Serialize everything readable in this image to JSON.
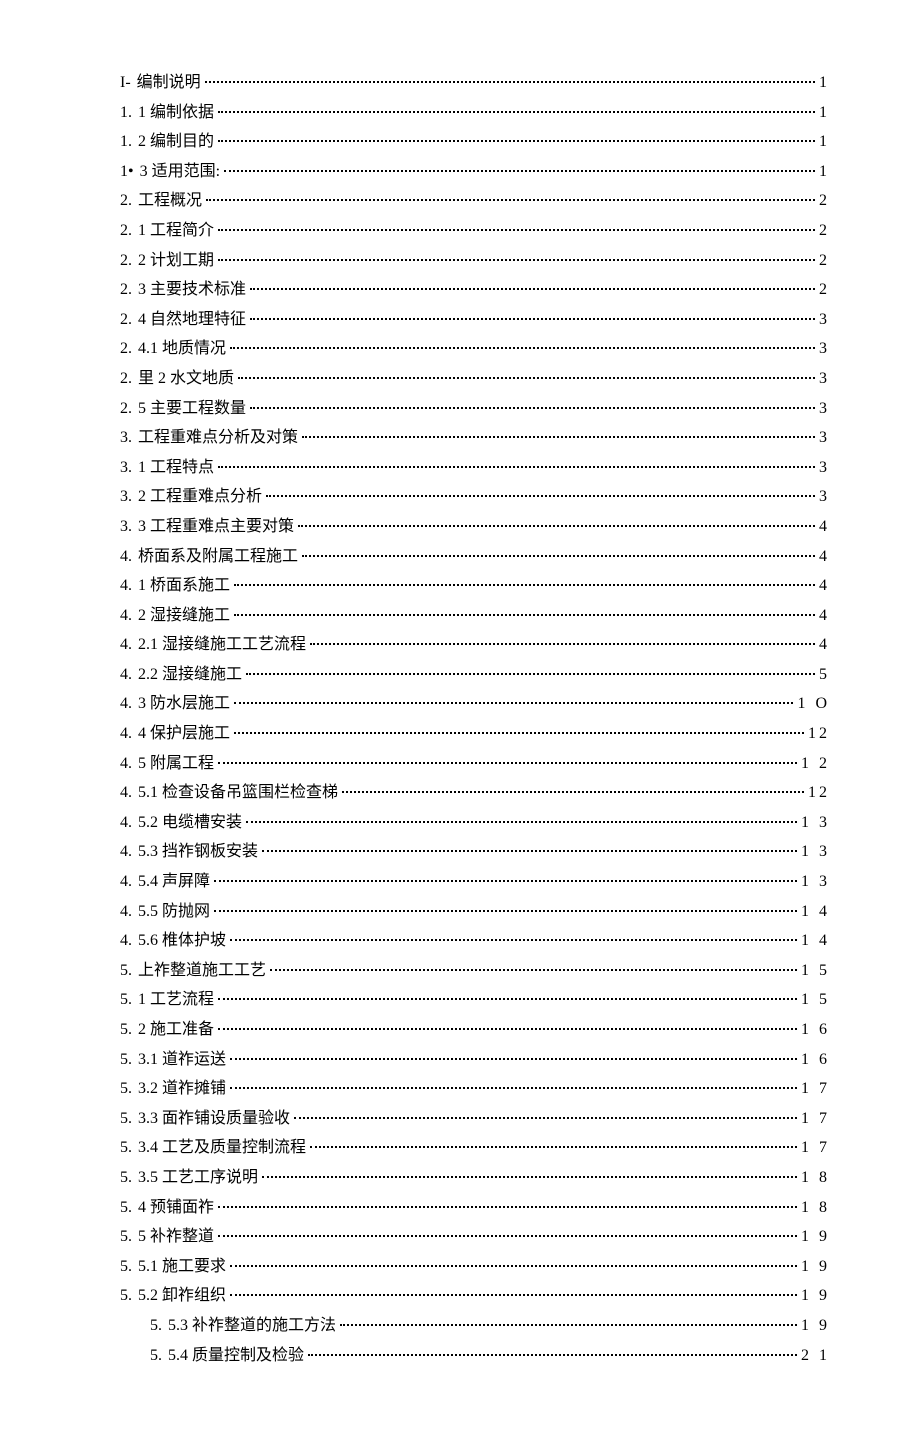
{
  "toc": [
    {
      "prefix": "I-",
      "label": "编制说明",
      "page": "1",
      "indent": 0
    },
    {
      "prefix": "1.",
      "label": "1 编制依据",
      "page": "1",
      "indent": 0
    },
    {
      "prefix": "1.",
      "label": "2 编制目的",
      "page": "1",
      "indent": 0
    },
    {
      "prefix": "1•",
      "label": "3 适用范围:",
      "page": "1",
      "indent": 0
    },
    {
      "prefix": "2.",
      "label": "工程概况",
      "page": "2",
      "indent": 0
    },
    {
      "prefix": "2.",
      "label": "1 工程简介",
      "page": "2",
      "indent": 0
    },
    {
      "prefix": "2.",
      "label": "2 计划工期",
      "page": "2",
      "indent": 0
    },
    {
      "prefix": "2.",
      "label": "3 主要技术标准",
      "page": "2",
      "indent": 0
    },
    {
      "prefix": "2.",
      "label": "4 自然地理特征",
      "page": "3",
      "indent": 0
    },
    {
      "prefix": "2.",
      "label": "4.1 地质情况",
      "page": "3",
      "indent": 0
    },
    {
      "prefix": "2.",
      "label": "里 2 水文地质",
      "page": "3",
      "indent": 0
    },
    {
      "prefix": "2.",
      "label": "5 主要工程数量",
      "page": "3",
      "indent": 0
    },
    {
      "prefix": "3.",
      "label": "工程重难点分析及对策",
      "page": "3",
      "indent": 0
    },
    {
      "prefix": "3.",
      "label": "1 工程特点",
      "page": "3",
      "indent": 0
    },
    {
      "prefix": "3.",
      "label": "2 工程重难点分析",
      "page": "3",
      "indent": 0
    },
    {
      "prefix": "3.",
      "label": "3 工程重难点主要对策",
      "page": "4",
      "indent": 0
    },
    {
      "prefix": "4.",
      "label": "桥面系及附属工程施工",
      "page": "4",
      "indent": 0
    },
    {
      "prefix": "4.",
      "label": "1 桥面系施工",
      "page": "4",
      "indent": 0
    },
    {
      "prefix": "4.",
      "label": "2 湿接缝施工",
      "page": "4",
      "indent": 0
    },
    {
      "prefix": "4.",
      "label": "2.1 湿接缝施工工艺流程",
      "page": "4",
      "indent": 0
    },
    {
      "prefix": "4.",
      "label": "2.2 湿接缝施工",
      "page": "5",
      "indent": 0
    },
    {
      "prefix": "4.",
      "label": "3 防水层施工",
      "page": "1 O",
      "indent": 0
    },
    {
      "prefix": "4.",
      "label": "4 保护层施工",
      "page": "12",
      "indent": 0
    },
    {
      "prefix": "4.",
      "label": "5 附属工程",
      "page": "1 2",
      "indent": 0
    },
    {
      "prefix": "4.",
      "label": "5.1 检查设备吊篮围栏检查梯",
      "page": "12",
      "indent": 0
    },
    {
      "prefix": "4.",
      "label": "5.2 电缆槽安装",
      "page": "1 3",
      "indent": 0
    },
    {
      "prefix": "4.",
      "label": "5.3 挡祚钢板安装",
      "page": "1 3",
      "indent": 0
    },
    {
      "prefix": "4.",
      "label": "5.4 声屏障",
      "page": "1 3",
      "indent": 0
    },
    {
      "prefix": "4.",
      "label": "5.5 防抛网",
      "page": "1 4",
      "indent": 0
    },
    {
      "prefix": "4.",
      "label": "5.6 椎体护坡",
      "page": "1 4",
      "indent": 0
    },
    {
      "prefix": "5.",
      "label": "上祚整道施工工艺",
      "page": "1 5",
      "indent": 0
    },
    {
      "prefix": "5.",
      "label": "1 工艺流程",
      "page": "1 5",
      "indent": 0
    },
    {
      "prefix": "5.",
      "label": "2 施工准备",
      "page": "1 6",
      "indent": 0
    },
    {
      "prefix": "5.",
      "label": "3.1 道祚运送",
      "page": "1 6",
      "indent": 0
    },
    {
      "prefix": "5.",
      "label": "3.2 道祚摊铺",
      "page": "1 7",
      "indent": 0
    },
    {
      "prefix": "5.",
      "label": "3.3 面祚铺设质量验收",
      "page": "1 7",
      "indent": 0
    },
    {
      "prefix": "5.",
      "label": "3.4 工艺及质量控制流程",
      "page": "1 7",
      "indent": 0
    },
    {
      "prefix": "5.",
      "label": "3.5 工艺工序说明",
      "page": "1 8",
      "indent": 0
    },
    {
      "prefix": "5.",
      "label": "4 预铺面祚",
      "page": "1 8",
      "indent": 0
    },
    {
      "prefix": "5.",
      "label": "5 补祚整道",
      "page": "1 9",
      "indent": 0
    },
    {
      "prefix": "5.",
      "label": "5.1 施工要求",
      "page": "1 9",
      "indent": 0
    },
    {
      "prefix": "5.",
      "label": "5.2 卸祚组织",
      "page": "1 9",
      "indent": 0
    },
    {
      "prefix": "5.",
      "label": "5.3 补祚整道的施工方法",
      "page": "1 9",
      "indent": 1
    },
    {
      "prefix": "5.",
      "label": "5.4 质量控制及检验",
      "page": "2 1",
      "indent": 1
    }
  ]
}
